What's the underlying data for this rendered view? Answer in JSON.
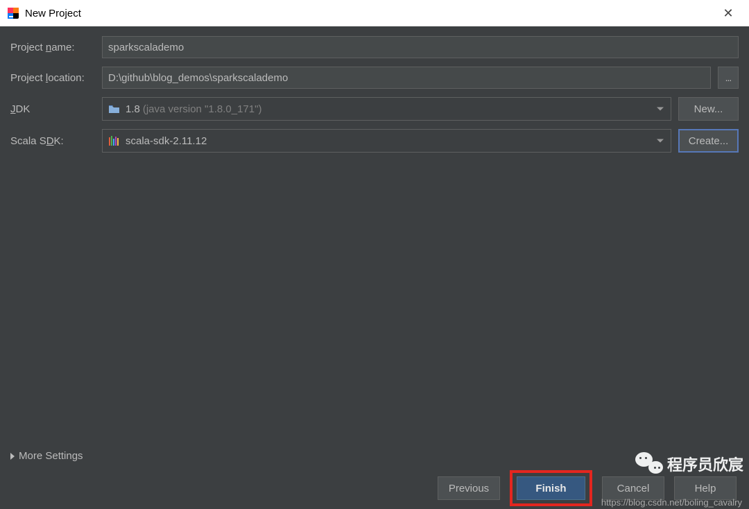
{
  "titlebar": {
    "title": "New Project"
  },
  "form": {
    "project_name": {
      "label_pre": "Project ",
      "label_u": "n",
      "label_post": "ame:",
      "value": "sparkscalademo"
    },
    "project_location": {
      "label_pre": "Project ",
      "label_u": "l",
      "label_post": "ocation:",
      "value": "D:\\github\\blog_demos\\sparkscalademo",
      "browse_label": "..."
    },
    "jdk": {
      "label_u": "J",
      "label_post": "DK",
      "value": "1.8",
      "hint": "(java version \"1.8.0_171\")",
      "action_label": "New..."
    },
    "scala_sdk": {
      "label_pre": "Scala S",
      "label_u": "D",
      "label_post": "K:",
      "value": "scala-sdk-2.11.12",
      "action_label": "Create..."
    }
  },
  "more_settings": {
    "label_pre": "Mor",
    "label_u": "e",
    "label_post": " Settings"
  },
  "footer": {
    "previous": "Previous",
    "finish": "Finish",
    "cancel": "Cancel",
    "help": "Help"
  },
  "watermark": {
    "text": "程序员欣宸",
    "url": "https://blog.csdn.net/boling_cavalry"
  }
}
